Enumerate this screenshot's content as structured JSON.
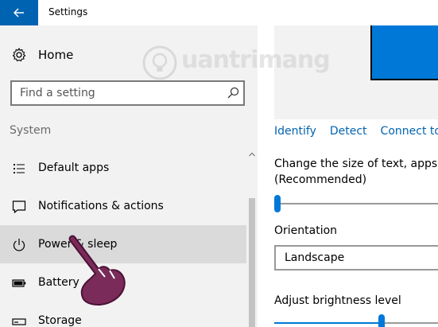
{
  "window": {
    "title": "Settings",
    "accent": "#0078d7",
    "back_icon": "back-arrow-icon"
  },
  "sidebar": {
    "home_label": "Home",
    "search_placeholder": "Find a setting",
    "section_label": "System",
    "items": [
      {
        "label": "Default apps",
        "icon": "default-apps-icon",
        "selected": false
      },
      {
        "label": "Notifications & actions",
        "icon": "notifications-icon",
        "selected": false
      },
      {
        "label": "Power & sleep",
        "icon": "power-icon",
        "selected": true
      },
      {
        "label": "Battery",
        "icon": "battery-icon",
        "selected": false
      },
      {
        "label": "Storage",
        "icon": "storage-icon",
        "selected": false
      }
    ]
  },
  "main": {
    "links": [
      "Identify",
      "Detect",
      "Connect to"
    ],
    "scale_label_line1": "Change the size of text, apps, a",
    "scale_label_line2": "(Recommended)",
    "scale_value": 0,
    "orientation_label": "Orientation",
    "orientation_value": "Landscape",
    "brightness_label": "Adjust brightness level",
    "brightness_value": 0.66
  },
  "watermark": {
    "text": "uantrimang"
  }
}
